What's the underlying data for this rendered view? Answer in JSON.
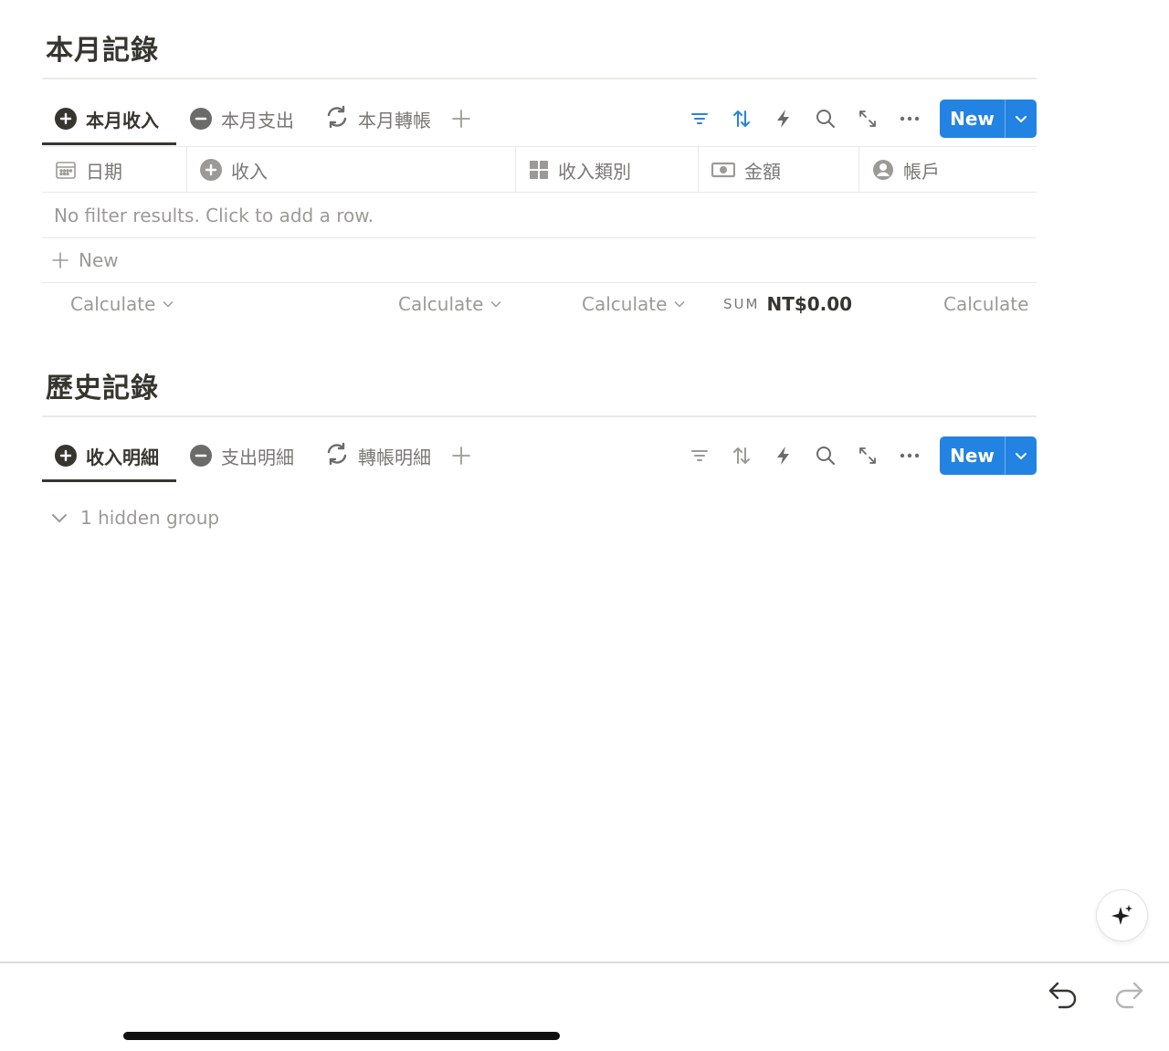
{
  "sections": {
    "current": {
      "title": "本月記錄",
      "tabs": [
        {
          "label": "本月收入",
          "icon": "plus-circle-icon"
        },
        {
          "label": "本月支出",
          "icon": "minus-circle-icon"
        },
        {
          "label": "本月轉帳",
          "icon": "refresh-icon"
        }
      ],
      "new_label": "New",
      "columns": [
        {
          "label": "日期",
          "icon": "calendar-icon"
        },
        {
          "label": "收入",
          "icon": "plus-circle-icon"
        },
        {
          "label": "收入類別",
          "icon": "grid-icon"
        },
        {
          "label": "金額",
          "icon": "money-icon"
        },
        {
          "label": "帳戶",
          "icon": "person-icon"
        }
      ],
      "empty_message": "No filter results. Click to add a row.",
      "new_row_label": "New",
      "calculate": {
        "col1": "Calculate",
        "col2": "Calculate",
        "col3": "Calculate",
        "sum_label": "SUM",
        "sum_value": "NT$0.00",
        "col5": "Calculate"
      }
    },
    "history": {
      "title": "歷史記錄",
      "tabs": [
        {
          "label": "收入明細",
          "icon": "plus-circle-icon"
        },
        {
          "label": "支出明細",
          "icon": "minus-circle-icon"
        },
        {
          "label": "轉帳明細",
          "icon": "refresh-icon"
        }
      ],
      "new_label": "New",
      "hidden_group": "1 hidden group"
    }
  },
  "colors": {
    "accent": "#2383e2",
    "text": "#37352f",
    "muted": "#9b9a97"
  }
}
